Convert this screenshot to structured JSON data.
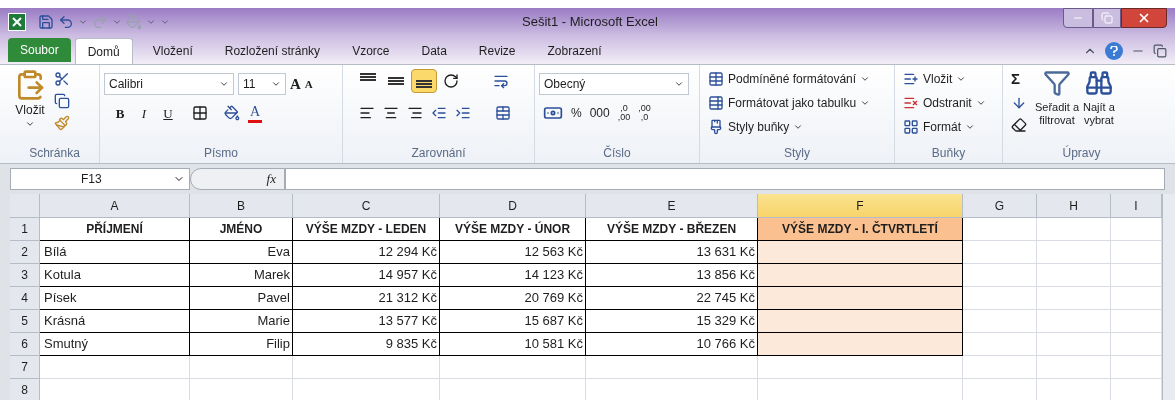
{
  "window": {
    "title": "Sešit1  -  Microsoft Excel"
  },
  "tabs": [
    {
      "label": "Soubor",
      "kind": "file",
      "selected": false
    },
    {
      "label": "Domů",
      "kind": "tab",
      "selected": true
    },
    {
      "label": "Vložení",
      "kind": "tab",
      "selected": false
    },
    {
      "label": "Rozložení stránky",
      "kind": "tab",
      "selected": false
    },
    {
      "label": "Vzorce",
      "kind": "tab",
      "selected": false
    },
    {
      "label": "Data",
      "kind": "tab",
      "selected": false
    },
    {
      "label": "Revize",
      "kind": "tab",
      "selected": false
    },
    {
      "label": "Zobrazení",
      "kind": "tab",
      "selected": false
    }
  ],
  "clipboard": {
    "group": "Schránka",
    "paste": "Vložit"
  },
  "font": {
    "group": "Písmo",
    "name": "Calibri",
    "size": "11",
    "grow": "A",
    "shrink": "A",
    "styles": [
      {
        "label": "B",
        "kind": "bold"
      },
      {
        "label": "I",
        "kind": "italic"
      },
      {
        "label": "U",
        "kind": "underline"
      }
    ],
    "color_label": "A"
  },
  "alignment": {
    "group": "Zarovnání",
    "vertical": [
      {
        "kind": "top",
        "selected": false
      },
      {
        "kind": "middle",
        "selected": false
      },
      {
        "kind": "bottom",
        "selected": true
      }
    ]
  },
  "number": {
    "group": "Číslo",
    "format": "Obecný",
    "buttons": [
      "%",
      "000"
    ],
    "decimals": [
      {
        "top": ",0",
        "bottom": ",00"
      },
      {
        "top": ",00",
        "bottom": ",0"
      }
    ]
  },
  "styles": {
    "group": "Styly",
    "items": [
      "Podmíněné formátování",
      "Formátovat jako tabulku",
      "Styly buňky"
    ]
  },
  "cells": {
    "group": "Buňky",
    "items": [
      {
        "label": "Vložit",
        "kind": "insert"
      },
      {
        "label": "Odstranit",
        "kind": "delete"
      },
      {
        "label": "Formát",
        "kind": "format"
      }
    ]
  },
  "editing": {
    "group": "Úpravy",
    "sum": "Σ",
    "sort": [
      "Seřadit a",
      "filtrovat"
    ],
    "find": [
      "Najít a",
      "vybrat"
    ]
  },
  "formula_bar": {
    "name_box": "F13",
    "function_label": "fx"
  },
  "sheet": {
    "columns": [
      {
        "label": "A",
        "selected": false,
        "shaded": false
      },
      {
        "label": "B",
        "selected": false,
        "shaded": false
      },
      {
        "label": "C",
        "selected": false,
        "shaded": false
      },
      {
        "label": "D",
        "selected": false,
        "shaded": false
      },
      {
        "label": "E",
        "selected": false,
        "shaded": false
      },
      {
        "label": "F",
        "selected": true,
        "shaded": true
      },
      {
        "label": "G",
        "selected": false,
        "shaded": false
      },
      {
        "label": "H",
        "selected": false,
        "shaded": false
      },
      {
        "label": "I",
        "selected": false,
        "shaded": false
      }
    ],
    "rows": [
      {
        "number": "1",
        "kind": "header",
        "cells": [
          "PŘÍJMENÍ",
          "JMÉNO",
          "VÝŠE MZDY - LEDEN",
          "VÝŠE MZDY - ÚNOR",
          "VÝŠE MZDY - BŘEZEN",
          "VÝŠE MZDY - I. ČTVRTLETÍ"
        ]
      },
      {
        "number": "2",
        "kind": "data",
        "cells": [
          "Bílá",
          "Eva",
          "12 294 Kč",
          "12 563 Kč",
          "13 631 Kč"
        ]
      },
      {
        "number": "3",
        "kind": "data",
        "cells": [
          "Kotula",
          "Marek",
          "14 957 Kč",
          "14 123 Kč",
          "13 856 Kč"
        ]
      },
      {
        "number": "4",
        "kind": "data",
        "cells": [
          "Písek",
          "Pavel",
          "21 312 Kč",
          "20 769 Kč",
          "22 745 Kč"
        ]
      },
      {
        "number": "5",
        "kind": "data",
        "cells": [
          "Krásná",
          "Marie",
          "13 577 Kč",
          "15 687 Kč",
          "15 329 Kč"
        ]
      },
      {
        "number": "6",
        "kind": "data",
        "cells": [
          "Smutný",
          "Filip",
          "9 835 Kč",
          "10 581 Kč",
          "10 766 Kč"
        ]
      },
      {
        "number": "7",
        "kind": "empty"
      },
      {
        "number": "8",
        "kind": "empty"
      }
    ]
  }
}
